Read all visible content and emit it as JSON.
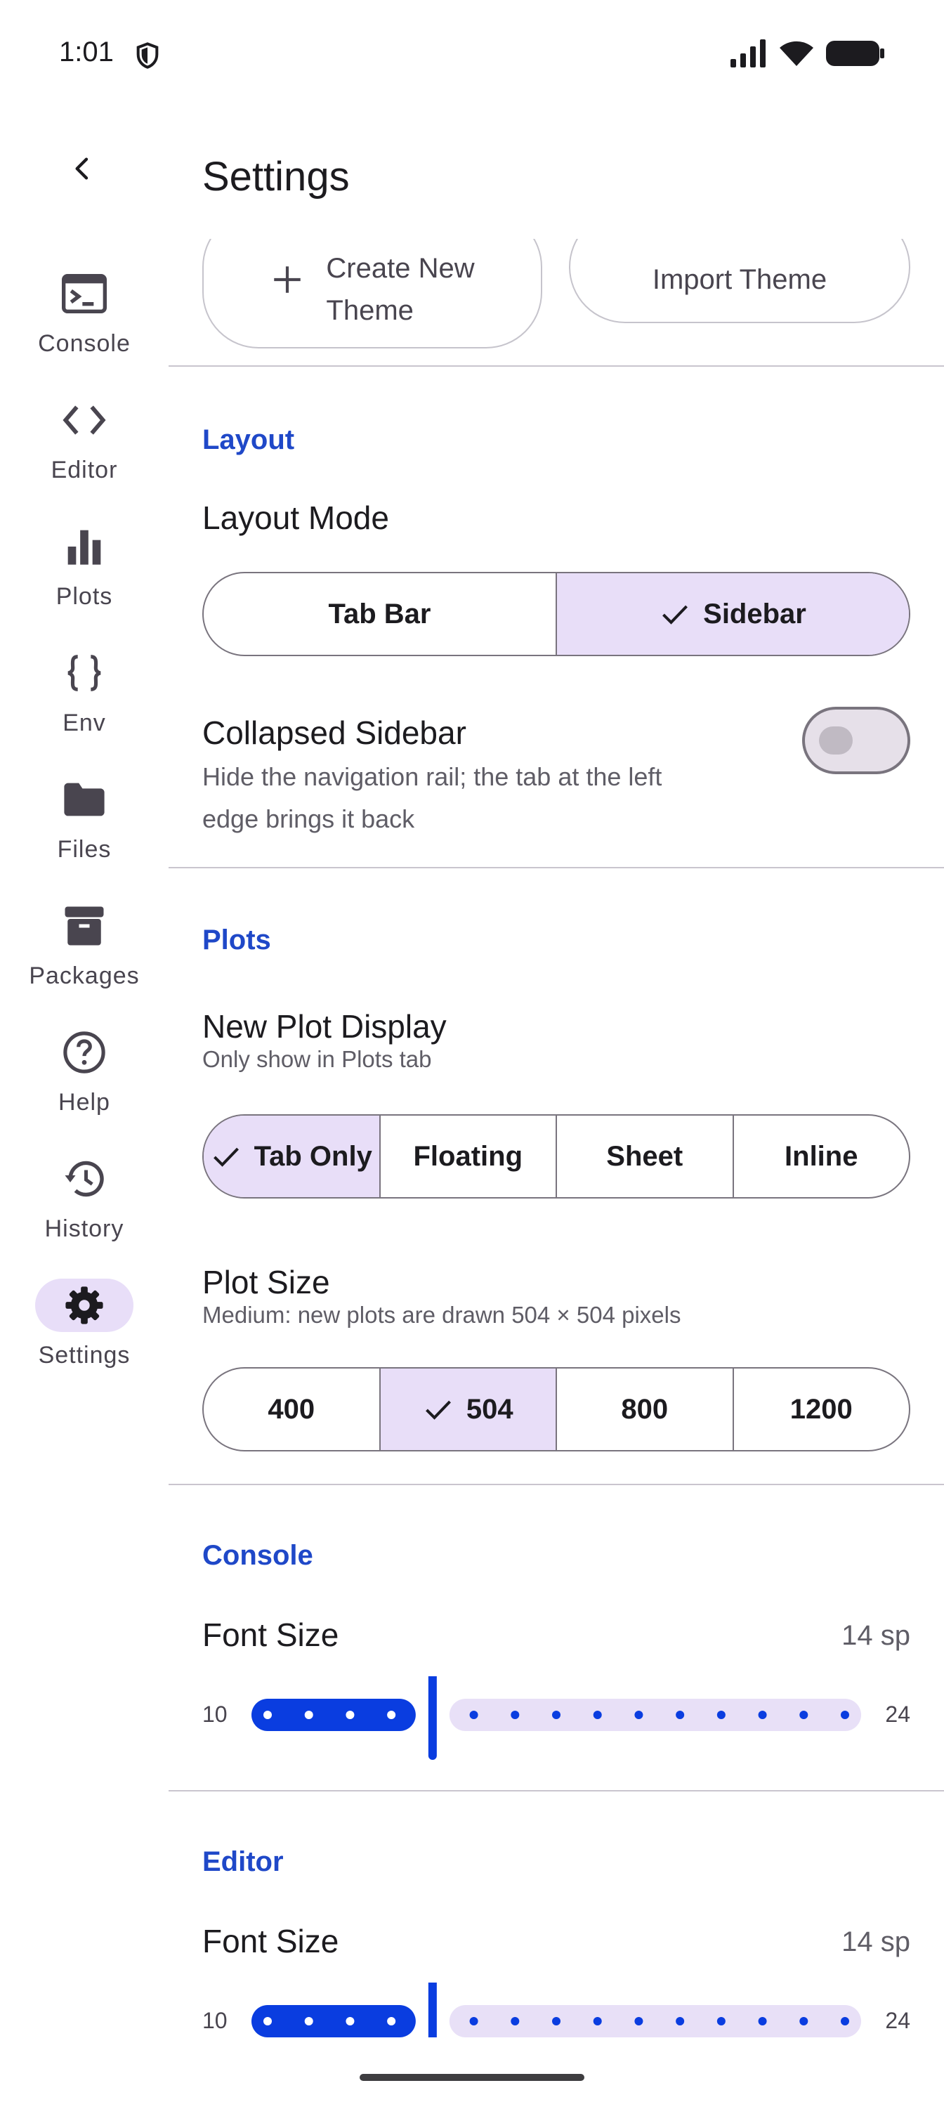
{
  "status_bar": {
    "time": "1:01"
  },
  "title": "Settings",
  "nav": {
    "items": [
      {
        "label": "Console",
        "icon": "terminal-icon"
      },
      {
        "label": "Editor",
        "icon": "code-icon"
      },
      {
        "label": "Plots",
        "icon": "bar-chart-icon"
      },
      {
        "label": "Env",
        "icon": "braces-icon"
      },
      {
        "label": "Files",
        "icon": "folder-icon"
      },
      {
        "label": "Packages",
        "icon": "archive-icon"
      },
      {
        "label": "Help",
        "icon": "help-icon"
      },
      {
        "label": "History",
        "icon": "history-icon"
      },
      {
        "label": "Settings",
        "icon": "gear-icon",
        "active": true
      }
    ]
  },
  "theme": {
    "create_label_line1": "Create New",
    "create_label_line2": "Theme",
    "import_label": "Import Theme"
  },
  "layout": {
    "section": "Layout",
    "mode_title": "Layout Mode",
    "options": [
      "Tab Bar",
      "Sidebar"
    ],
    "selected": "Sidebar",
    "collapsed_title": "Collapsed Sidebar",
    "collapsed_desc_line1": "Hide the navigation rail; the tab at the left",
    "collapsed_desc_line2": "edge brings it back",
    "collapsed_on": false
  },
  "plots": {
    "section": "Plots",
    "display_title": "New Plot Display",
    "display_desc": "Only show in Plots tab",
    "display_options": [
      "Tab Only",
      "Floating",
      "Sheet",
      "Inline"
    ],
    "display_selected": "Tab Only",
    "size_title": "Plot Size",
    "size_desc": "Medium: new plots are drawn 504 × 504 pixels",
    "size_options": [
      "400",
      "504",
      "800",
      "1200"
    ],
    "size_selected": "504"
  },
  "console": {
    "section": "Console",
    "font_title": "Font Size",
    "font_value_text": "14 sp",
    "font_value": 14,
    "min_label": "10",
    "max_label": "24",
    "min": 10,
    "max": 24
  },
  "editor": {
    "section": "Editor",
    "font_title": "Font Size",
    "font_value_text": "14 sp",
    "font_value": 14,
    "min_label": "10",
    "max_label": "24",
    "min": 10,
    "max": 24
  },
  "colors": {
    "accent": "#1f48c8",
    "selected_bg": "#e8def8",
    "slider_active": "#0a3de0",
    "slider_inactive": "#e8e0f7"
  }
}
